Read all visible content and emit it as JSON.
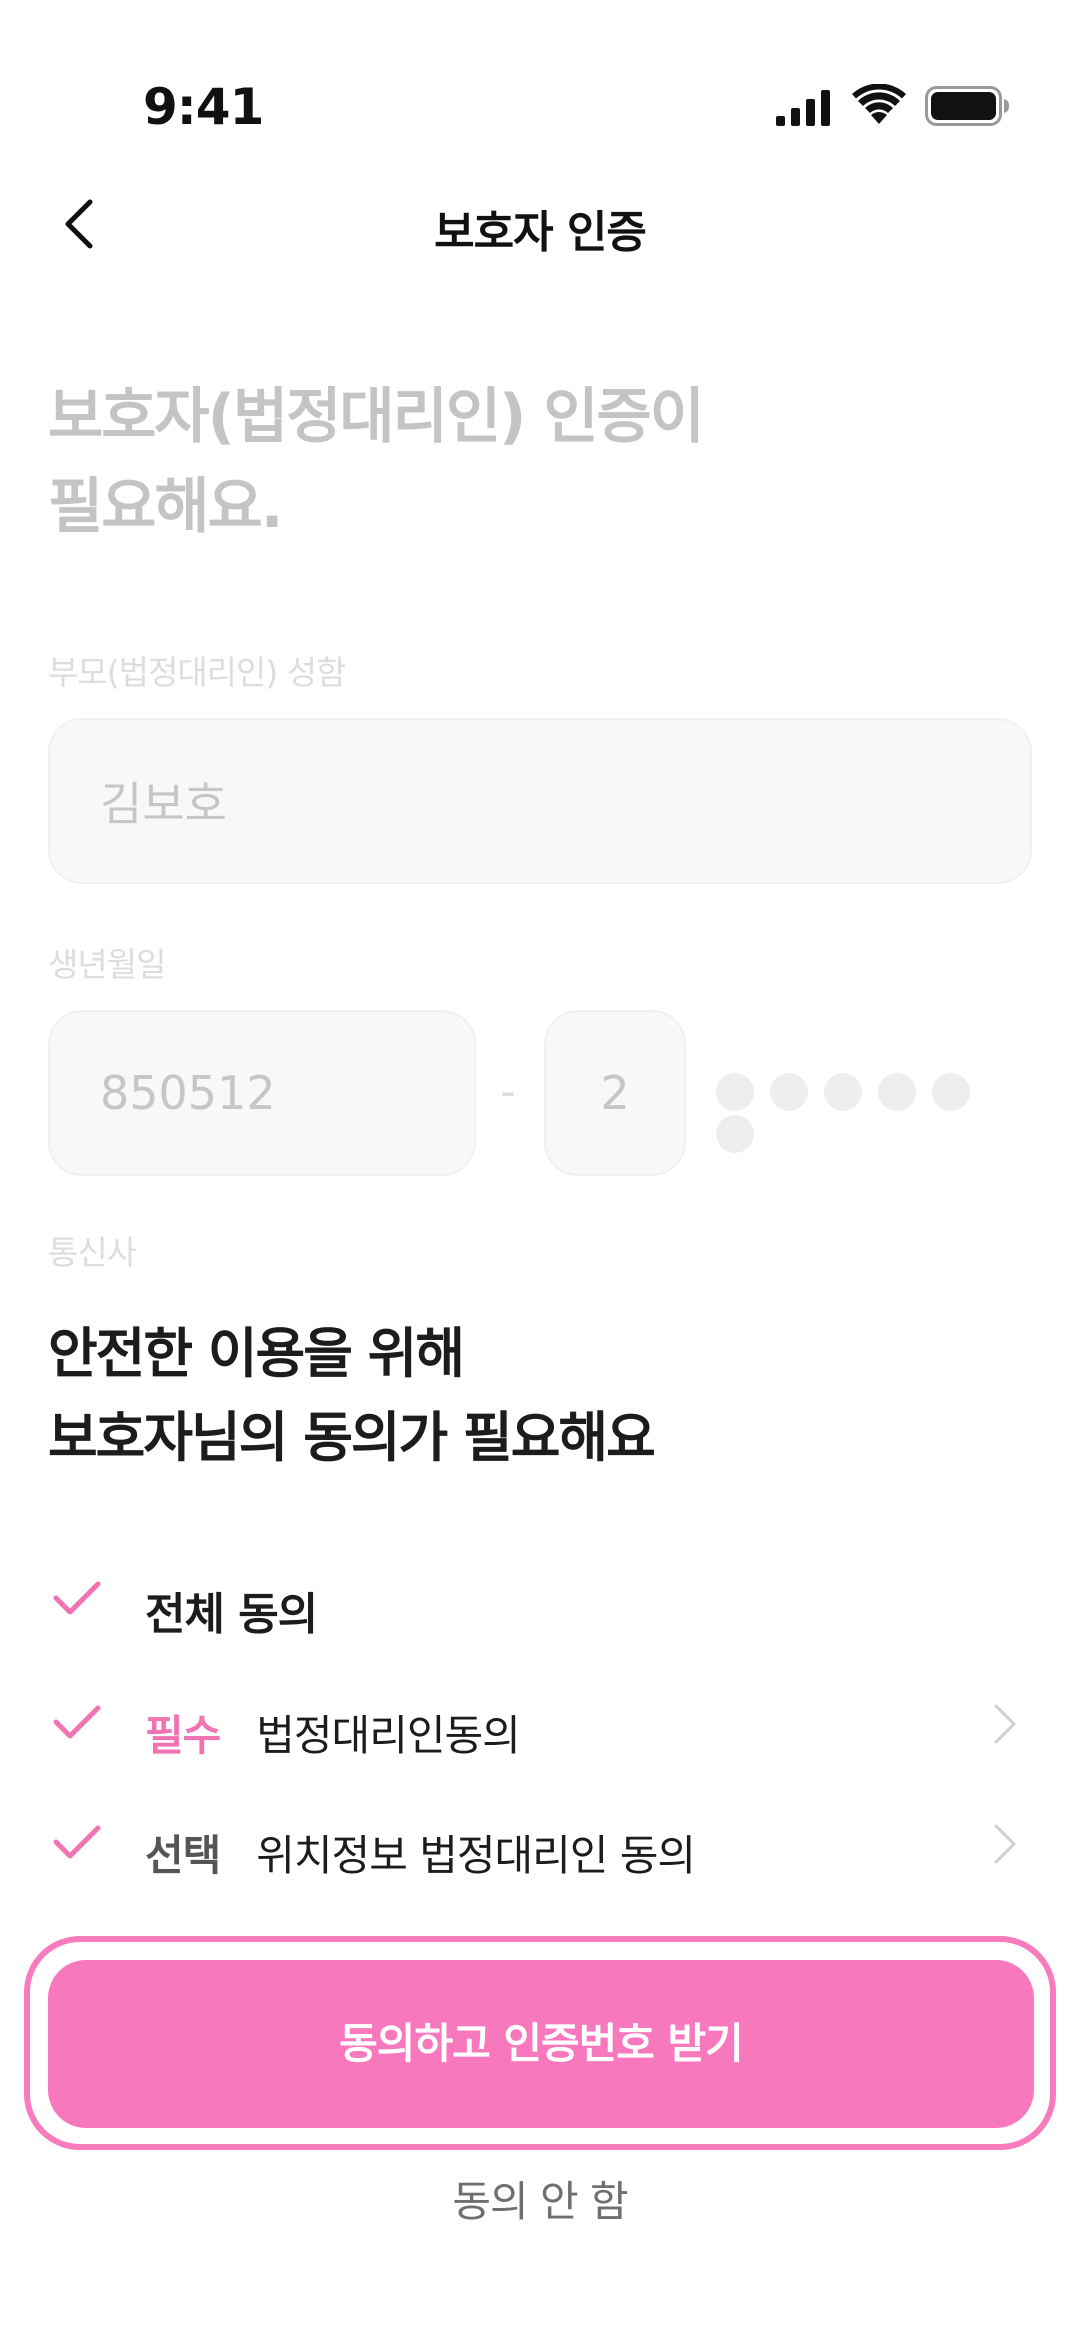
{
  "status_bar": {
    "time": "9:41"
  },
  "header": {
    "title": "보호자 인증"
  },
  "background_form": {
    "heading_line1": "보호자(법정대리인) 인증이",
    "heading_line2": "필요해요.",
    "name_label": "부모(법정대리인) 성함",
    "name_placeholder": "김보호",
    "birth_label": "생년월일",
    "birth_placeholder": "850512",
    "separator": "-",
    "gender_digit_placeholder": "2",
    "carrier_label": "통신사"
  },
  "consent_sheet": {
    "title_line1": "안전한 이용을 위해",
    "title_line2": "보호자님의 동의가 필요해요",
    "all_agree_label": "전체 동의",
    "items": [
      {
        "tag": "필수",
        "label": "법정대리인동의"
      },
      {
        "tag": "선택",
        "label": "위치정보 법정대리인 동의"
      }
    ],
    "primary_button": "동의하고 인증번호 받기",
    "decline_button": "동의 안 함"
  },
  "colors": {
    "accent": "#f878be",
    "check": "#f073b4",
    "text": "#1c1c1c"
  },
  "icons": [
    "back-arrow-icon",
    "signal-icon",
    "wifi-icon",
    "battery-icon",
    "check-icon",
    "chevron-right-icon"
  ]
}
